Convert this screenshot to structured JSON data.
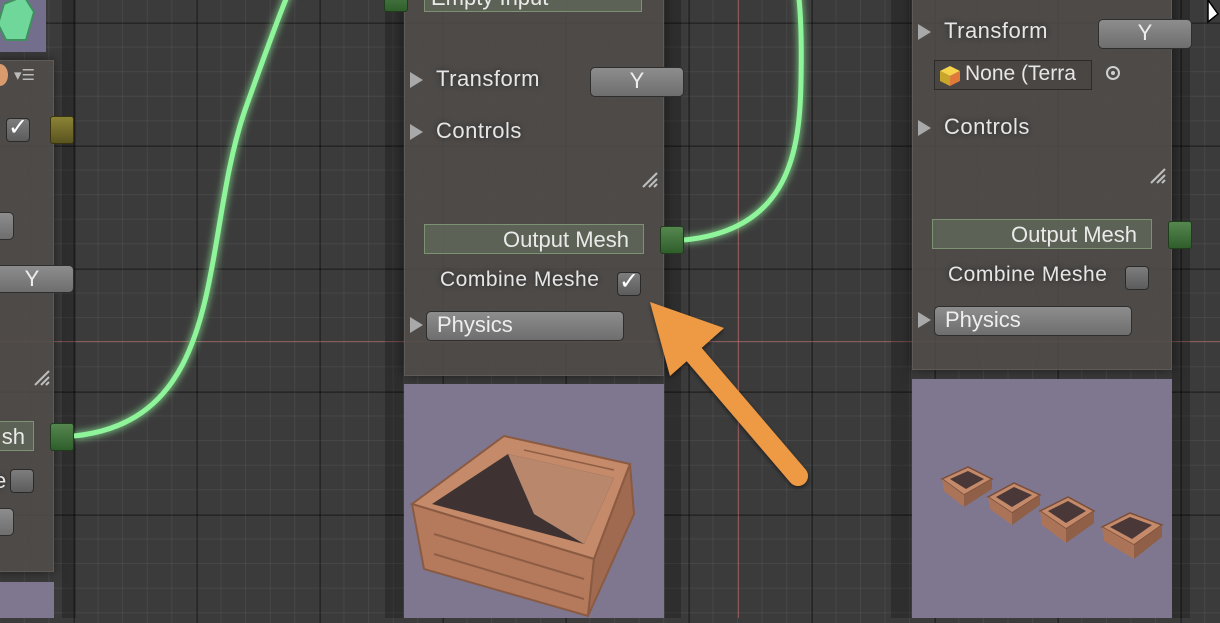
{
  "node_left": {
    "y_button": "Y",
    "port_partial_label": "sh",
    "partial_checkbox_label": "e"
  },
  "node_middle": {
    "top_partial_label": "Empty Input",
    "transform_label": "Transform",
    "transform_axis": "Y",
    "controls_label": "Controls",
    "output_label": "Output Mesh",
    "combine_label": "Combine Meshe",
    "combine_checked": true,
    "physics_label": "Physics"
  },
  "node_right": {
    "transform_label": "Transform",
    "transform_axis": "Y",
    "object_field": "None (Terra",
    "controls_label": "Controls",
    "output_label": "Output Mesh",
    "combine_label": "Combine Meshe",
    "combine_checked": false,
    "physics_label": "Physics"
  },
  "colors": {
    "connection": "#8ff59a",
    "arrow": "#ee9a45",
    "preview_bg": "#7f778f",
    "wood": "#c48a6a"
  }
}
